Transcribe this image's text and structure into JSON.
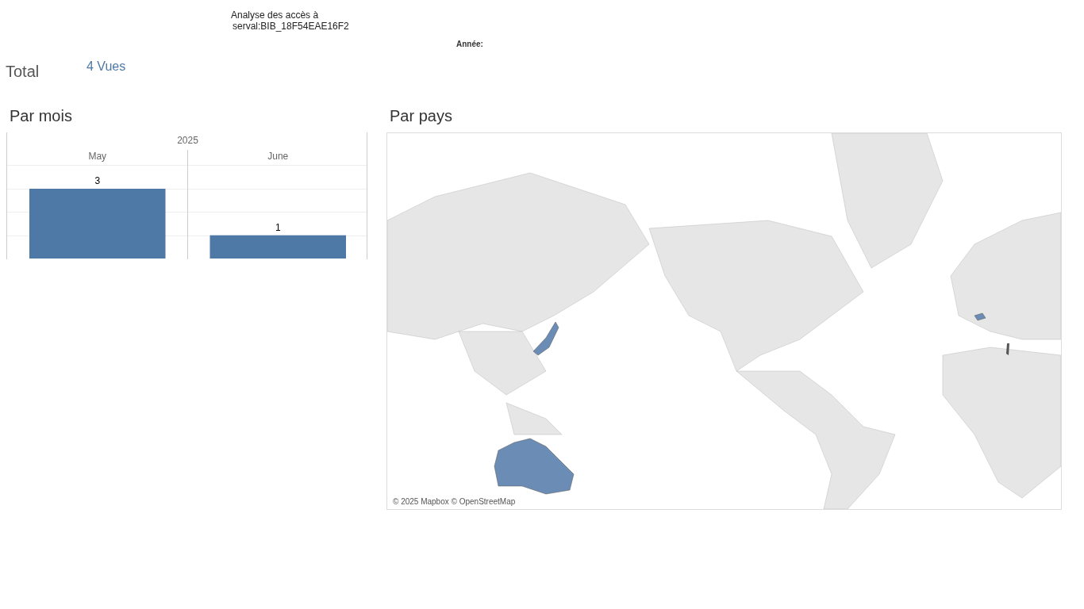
{
  "header": {
    "title_line_1": "Analyse des accès à",
    "title_line_2": "serval:BIB_18F54EAE16F2",
    "year_filter_label": "Année:"
  },
  "total": {
    "label": "Total",
    "value": "4 Vues"
  },
  "by_month": {
    "title": "Par mois",
    "year_header": "2025",
    "chart_data": {
      "type": "bar",
      "categories": [
        "May",
        "June"
      ],
      "values": [
        3,
        1
      ],
      "ylim": [
        0,
        3
      ],
      "data_labels": true
    }
  },
  "by_country": {
    "title": "Par pays",
    "attribution": "© 2025 Mapbox © OpenStreetMap"
  }
}
